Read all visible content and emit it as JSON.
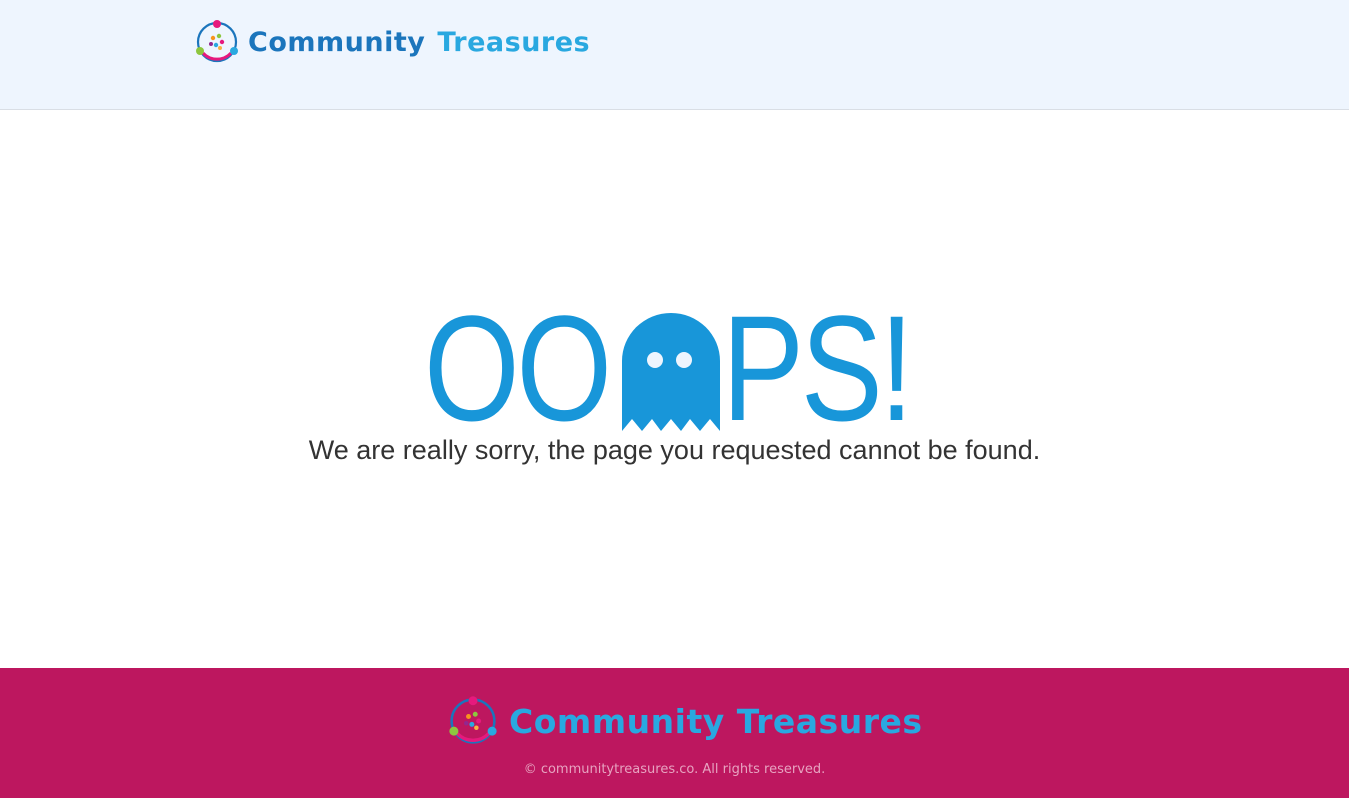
{
  "header": {
    "logo": {
      "icon": "community-treasures-logo-icon",
      "word1": "Community",
      "word2": "Treasures"
    }
  },
  "error": {
    "heading_left": "OO",
    "heading_icon": "ghost-icon",
    "heading_right": "PS!",
    "message": "We are really sorry, the page you requested cannot be found."
  },
  "footer": {
    "logo": {
      "icon": "community-treasures-logo-icon",
      "word1": "Community",
      "word2": "Treasures"
    },
    "copyright": "© communitytreasures.co. All rights reserved."
  },
  "colors": {
    "header_bg": "#eef5fe",
    "accent_blue": "#1896d9",
    "logo_dark_blue": "#1b75bc",
    "logo_light_blue": "#29a8e0",
    "footer_bg": "#bd175f",
    "text": "#333333"
  }
}
